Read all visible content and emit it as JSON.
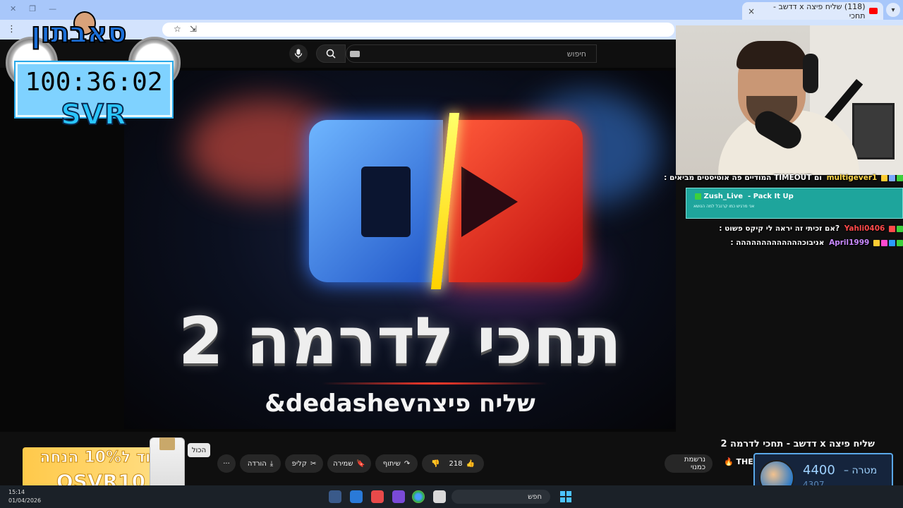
{
  "browser": {
    "tab_title": "(118) שליח פיצה x דדשב - תחכי",
    "tab_close": "×",
    "new_tab": "+",
    "menu": "⋮",
    "star": "☆"
  },
  "youtube": {
    "search_placeholder": "חיפוש",
    "video_title": "שליח פיצה x דדשב - תחכי לדרמה 2",
    "channel": "THE D",
    "subscribe_label": "נרשמת כמנוי",
    "likes": "218",
    "share_label": "שיתוף",
    "save_label": "שמירה",
    "clip_label": "קליפ",
    "download_label": "הורדה",
    "more_label": "···",
    "all_tooltip": "הכול"
  },
  "thumbnail": {
    "title": "תחכי לדרמה 2",
    "subtitle": "שליח פיצהdedashev&"
  },
  "overlay": {
    "brand": "סאבתון",
    "timer": "100:36:02",
    "tag": "SVR"
  },
  "chat": {
    "lines": [
      {
        "user": "multigever1",
        "text": "ום TIMEOUT המודיים פה אוטיסטים מביאים :",
        "user_color": "#ffd84a"
      },
      {
        "user": "Yahli0406",
        "text": "?אם זכיתי זה יראה לי קיקס פשוט :",
        "user_color": "#ff4a4a"
      },
      {
        "user": "April1999",
        "text": "אניבוכההההההההההההה :",
        "user_color": "#c98aff"
      }
    ],
    "alert_user": "Zush_Live",
    "alert_song": "Pack It Up",
    "alert_sub": "אני מרגיש כמו קרנבל למה הנושא"
  },
  "promo": {
    "line1": "קוד ל10% הנחה",
    "line2": "OSVR10"
  },
  "goal": {
    "label": "מטרה",
    "dash": "–",
    "target": "4400",
    "current": "4307"
  },
  "taskbar": {
    "search_label": "חפש",
    "time": "15:14",
    "date": "01/04/2026"
  }
}
